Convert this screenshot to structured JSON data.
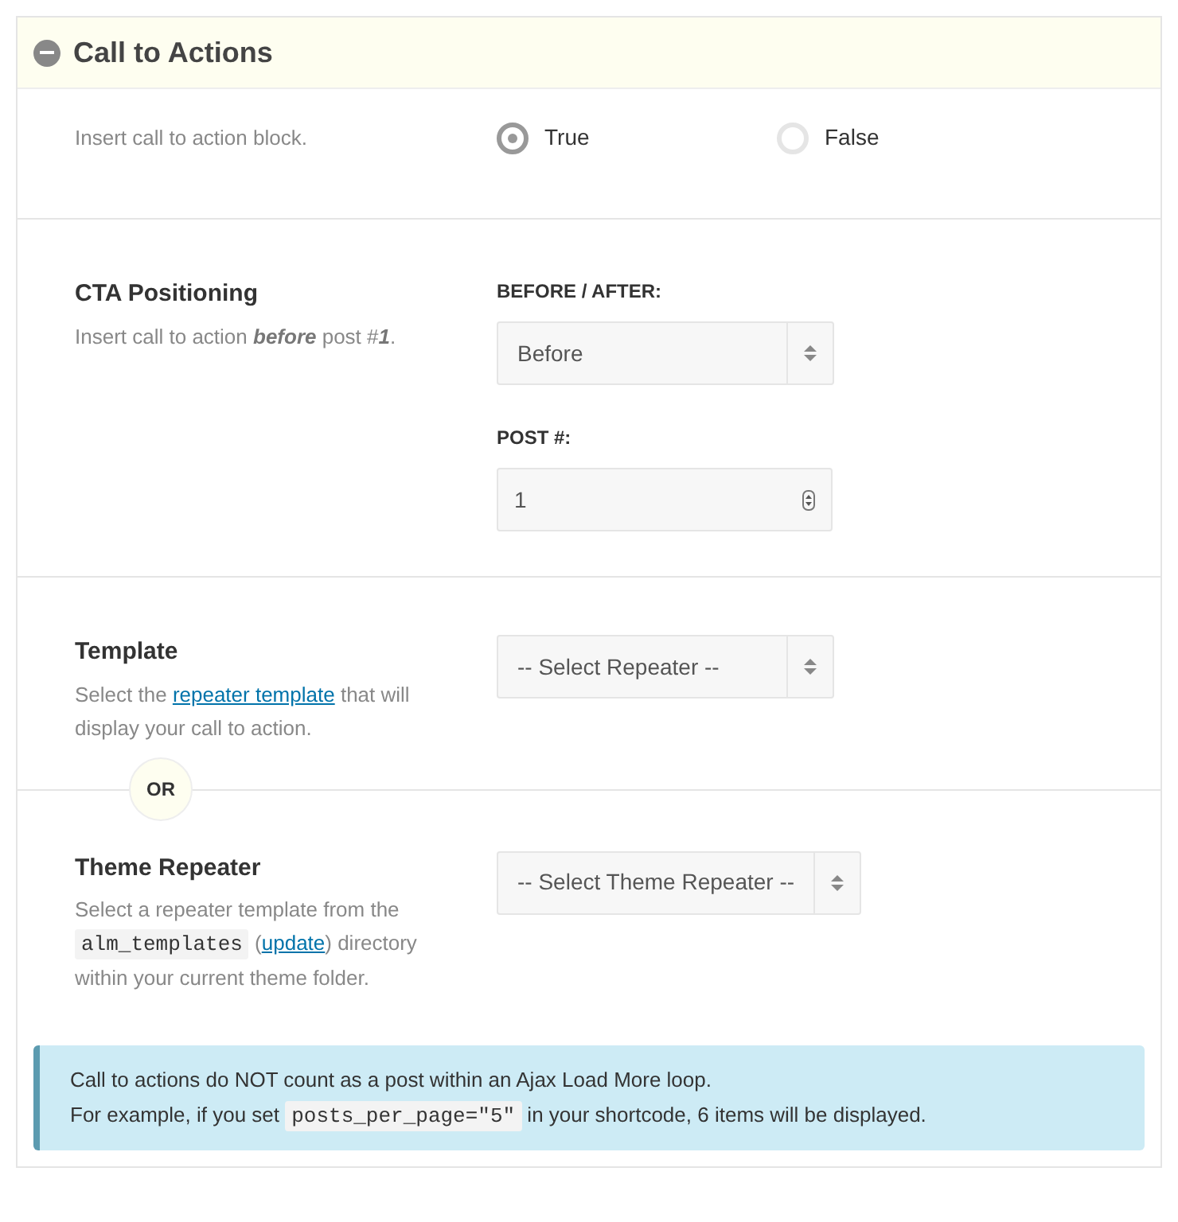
{
  "panel": {
    "title": "Call to Actions",
    "expanded": true
  },
  "rows": [
    {
      "kind": "radio",
      "description": [
        {
          "kind": "text",
          "text": "Insert call to action block."
        }
      ],
      "options": [
        {
          "label": "True",
          "selected": true
        },
        {
          "label": "False",
          "selected": false
        }
      ]
    },
    {
      "kind": "fields",
      "heading": "CTA Positioning",
      "description": [
        {
          "kind": "text",
          "text": "Insert call to action "
        },
        {
          "kind": "em",
          "text": "before"
        },
        {
          "kind": "text",
          "text": " post #"
        },
        {
          "kind": "em",
          "text": "1"
        },
        {
          "kind": "text",
          "text": "."
        }
      ],
      "fields": [
        {
          "kind": "select",
          "label": "BEFORE / AFTER:",
          "value": "Before"
        },
        {
          "kind": "number",
          "label": "POST #:",
          "value": "1"
        }
      ]
    },
    {
      "kind": "fields",
      "heading": "Template",
      "description": [
        {
          "kind": "text",
          "text": "Select the "
        },
        {
          "kind": "link",
          "text": "repeater template"
        },
        {
          "kind": "text",
          "text": " that will display your call to action."
        }
      ],
      "fields": [
        {
          "kind": "select",
          "value": "-- Select Repeater --"
        }
      ]
    },
    {
      "kind": "fields",
      "heading": "Theme Repeater",
      "divider_label": "OR",
      "description": [
        {
          "kind": "text",
          "text": "Select a repeater template from the "
        },
        {
          "kind": "code",
          "text": "alm_templates"
        },
        {
          "kind": "text",
          "text": " ("
        },
        {
          "kind": "link",
          "text": "update"
        },
        {
          "kind": "text",
          "text": ") directory within your current theme folder."
        }
      ],
      "fields": [
        {
          "kind": "select",
          "value": "-- Select Theme Repeater --"
        }
      ]
    }
  ],
  "notice": {
    "lines": [
      [
        {
          "kind": "text",
          "text": "Call to actions do NOT count as a post within an Ajax Load More loop."
        }
      ],
      [
        {
          "kind": "text",
          "text": "For example, if you set "
        },
        {
          "kind": "code",
          "text": "posts_per_page=\"5\""
        },
        {
          "kind": "text",
          "text": " in your shortcode, 6 items will be displayed."
        }
      ]
    ]
  }
}
